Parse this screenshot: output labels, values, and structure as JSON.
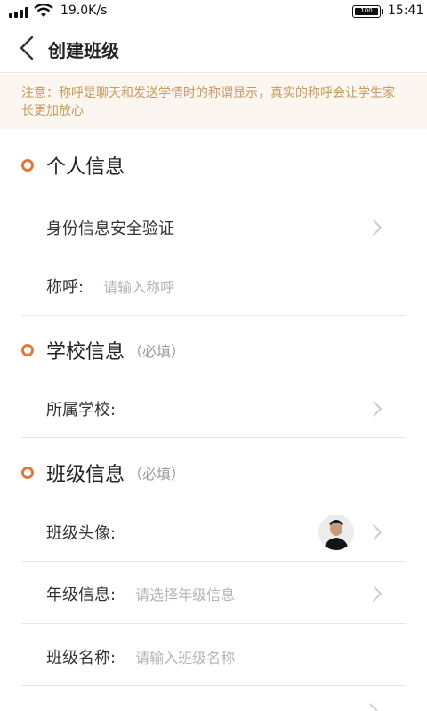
{
  "status_bar": {
    "net_speed": "19.0K/s",
    "battery": "100",
    "time": "15:41"
  },
  "nav": {
    "title": "创建班级",
    "back_icon": "chevron-left-icon"
  },
  "notice": {
    "text": "注意：称呼是聊天和发送学情时的称谓显示，真实的称呼会让学生家长更加放心"
  },
  "colors": {
    "accent": "#e2773d",
    "notice_bg": "#fbf6f0",
    "notice_text": "#c79a5e",
    "placeholder": "#b5b5b5"
  },
  "personal": {
    "title": "个人信息",
    "verify_label": "身份信息安全验证",
    "name_label": "称呼:",
    "name_placeholder": "请输入称呼"
  },
  "school": {
    "title": "学校信息",
    "hint": "（必填）",
    "school_label": "所属学校:"
  },
  "class": {
    "title": "班级信息",
    "hint": "（必填）",
    "avatar_label": "班级头像:",
    "grade_label": "年级信息:",
    "grade_placeholder": "请选择年级信息",
    "name_label": "班级名称:",
    "name_placeholder": "请输入班级名称"
  }
}
